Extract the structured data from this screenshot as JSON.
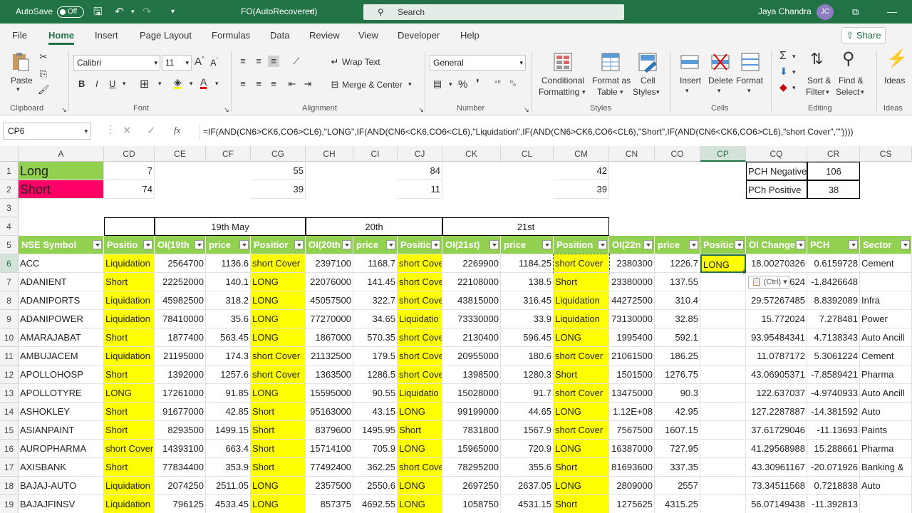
{
  "title_bar": {
    "autosave_label": "AutoSave",
    "autosave_state": "Off",
    "file_name": "FO(AutoRecovered)",
    "search_placeholder": "Search",
    "user_name": "Jaya Chandra",
    "user_initials": "JC"
  },
  "menu": {
    "tabs": [
      "File",
      "Home",
      "Insert",
      "Page Layout",
      "Formulas",
      "Data",
      "Review",
      "View",
      "Developer",
      "Help"
    ],
    "active": "Home",
    "share_label": "Share"
  },
  "ribbon": {
    "clipboard": {
      "paste": "Paste",
      "group": "Clipboard"
    },
    "font": {
      "family": "Calibri",
      "size": "11",
      "group": "Font",
      "bold": "B",
      "italic": "I",
      "underline": "U"
    },
    "alignment": {
      "wrap": "Wrap Text",
      "merge": "Merge & Center",
      "group": "Alignment"
    },
    "number": {
      "format": "General",
      "group": "Number",
      "percent": "%"
    },
    "styles": {
      "conditional": "Conditional",
      "conditional2": "Formatting",
      "format_as": "Format as",
      "format_as2": "Table",
      "cell": "Cell",
      "cell2": "Styles",
      "group": "Styles"
    },
    "cells": {
      "insert": "Insert",
      "delete": "Delete",
      "format": "Format",
      "group": "Cells"
    },
    "editing": {
      "sort": "Sort &",
      "sort2": "Filter",
      "find": "Find &",
      "find2": "Select",
      "group": "Editing"
    },
    "ideas": {
      "label": "Ideas",
      "group": "Ideas"
    }
  },
  "formula_bar": {
    "name_box": "CP6",
    "fx": "fx",
    "formula": "=IF(AND(CN6>CK6,CO6>CL6),\"LONG\",IF(AND(CN6<CK6,CO6<CL6),\"Liquidation\",IF(AND(CN6>CK6,CO6<CL6),\"Short\",IF(AND(CN6<CK6,CO6>CL6),\"short Cover\",\"\"))))"
  },
  "sheet": {
    "columns": [
      "A",
      "CD",
      "CE",
      "CF",
      "CG",
      "CH",
      "CI",
      "CJ",
      "CK",
      "CL",
      "CM",
      "CN",
      "CO",
      "CP",
      "CQ",
      "CR",
      "CS"
    ],
    "selected_column": "CP",
    "selected_row": "6",
    "row_numbers": [
      "1",
      "2",
      "3",
      "4",
      "5",
      "6",
      "7",
      "8",
      "9",
      "10",
      "11",
      "12",
      "13",
      "14",
      "15",
      "16",
      "17",
      "18",
      "19"
    ],
    "row1": {
      "label": "Long",
      "cd": "7",
      "cg": "55",
      "cj": "84",
      "cm": "42",
      "cq": "PCH Negative",
      "cr": "106"
    },
    "row2": {
      "label": "Short",
      "cd": "74",
      "cg": "39",
      "cj": "11",
      "cm": "39",
      "cq": "PCh Positive",
      "cr": "38"
    },
    "row4": {
      "d1": "19th May",
      "d2": "20th",
      "d3": "21st"
    },
    "headers": [
      "NSE Symbol",
      "Positio",
      "OI(19th",
      "price",
      "Positior",
      "OI(20th",
      "price",
      "Positic",
      "OI(21st)",
      "price",
      "Position",
      "OI(22n",
      "price",
      "Positic",
      "OI Change",
      "PCH",
      "Sector"
    ],
    "paste_tag": "(Ctrl)",
    "rows": [
      [
        "ACC",
        "Liquidation",
        "2564700",
        "1136.6",
        "short Cover",
        "2397100",
        "1168.7",
        "short Cove",
        "2269900",
        "1184.25",
        "short Cover",
        "2380300",
        "1226.7",
        "LONG",
        "18.00270326",
        "0.6159728",
        "Cement"
      ],
      [
        "ADANIENT",
        "Short",
        "22252000",
        "140.1",
        "LONG",
        "22076000",
        "141.45",
        "short Cove",
        "22108000",
        "138.5",
        "Short",
        "23380000",
        "137.55",
        "",
        "...624",
        "-1.8426648",
        ""
      ],
      [
        "ADANIPORTS",
        "Liquidation",
        "45982500",
        "318.2",
        "LONG",
        "45057500",
        "322.7",
        "short Cove",
        "43815000",
        "316.45",
        "Liquidation",
        "44272500",
        "310.4",
        "",
        "29.57267485",
        "8.8392089",
        "Infra"
      ],
      [
        "ADANIPOWER",
        "Liquidation",
        "78410000",
        "35.6",
        "LONG",
        "77270000",
        "34.65",
        "Liquidatio",
        "73330000",
        "33.9",
        "Liquidation",
        "73130000",
        "32.85",
        "",
        "15.772024",
        "7.278481",
        "Power"
      ],
      [
        "AMARAJABAT",
        "Short",
        "1877400",
        "563.45",
        "LONG",
        "1867000",
        "570.35",
        "short Cove",
        "2130400",
        "596.45",
        "LONG",
        "1995400",
        "592.1",
        "",
        "93.95484341",
        "4.7138343",
        "Auto Ancill"
      ],
      [
        "AMBUJACEM",
        "Liquidation",
        "21195000",
        "174.3",
        "short Cover",
        "21132500",
        "179.5",
        "short Cove",
        "20955000",
        "180.6",
        "short Cover",
        "21061500",
        "186.25",
        "",
        "11.0787172",
        "5.3061224",
        "Cement"
      ],
      [
        "APOLLOHOSP",
        "Short",
        "1392000",
        "1257.6",
        "short Cover",
        "1363500",
        "1286.5",
        "short Cove",
        "1398500",
        "1280.3",
        "Short",
        "1501500",
        "1276.75",
        "",
        "43.06905371",
        "-7.8589421",
        "Pharma"
      ],
      [
        "APOLLOTYRE",
        "LONG",
        "17261000",
        "91.85",
        "LONG",
        "15595000",
        "90.55",
        "Liquidatio",
        "15028000",
        "91.7",
        "short Cover",
        "13475000",
        "90.3",
        "",
        "122.637037",
        "-4.9740933",
        "Auto Ancill"
      ],
      [
        "ASHOKLEY",
        "Short",
        "91677000",
        "42.85",
        "Short",
        "95163000",
        "43.15",
        "LONG",
        "99199000",
        "44.65",
        "LONG",
        "1.12E+08",
        "42.95",
        "",
        "127.2287887",
        "-14.381592",
        "Auto"
      ],
      [
        "ASIANPAINT",
        "Short",
        "8293500",
        "1499.15",
        "Short",
        "8379600",
        "1495.95",
        "Short",
        "7831800",
        "1567.9",
        "short Cover",
        "7567500",
        "1607.15",
        "",
        "37.61729046",
        "-11.13693",
        "Paints"
      ],
      [
        "AUROPHARMA",
        "short Cover",
        "14393100",
        "663.4",
        "Short",
        "15714100",
        "705.9",
        "LONG",
        "15965000",
        "720.9",
        "LONG",
        "16387000",
        "727.95",
        "",
        "41.29568988",
        "15.288661",
        "Pharma"
      ],
      [
        "AXISBANK",
        "Short",
        "77834400",
        "353.9",
        "Short",
        "77492400",
        "362.25",
        "short Cove",
        "78295200",
        "355.6",
        "Short",
        "81693600",
        "337.35",
        "",
        "43.30961167",
        "-20.071926",
        "Banking &"
      ],
      [
        "BAJAJ-AUTO",
        "Liquidation",
        "2074250",
        "2511.05",
        "LONG",
        "2357500",
        "2550.6",
        "LONG",
        "2697250",
        "2637.05",
        "LONG",
        "2809000",
        "2557",
        "",
        "73.34511568",
        "0.7218838",
        "Auto"
      ],
      [
        "BAJAJFINSV",
        "Liquidation",
        "796125",
        "4533.45",
        "LONG",
        "857375",
        "4692.55",
        "LONG",
        "1058750",
        "4531.15",
        "Short",
        "1275625",
        "4315.25",
        "",
        "56.07149438",
        "-11.392813",
        ""
      ]
    ]
  }
}
